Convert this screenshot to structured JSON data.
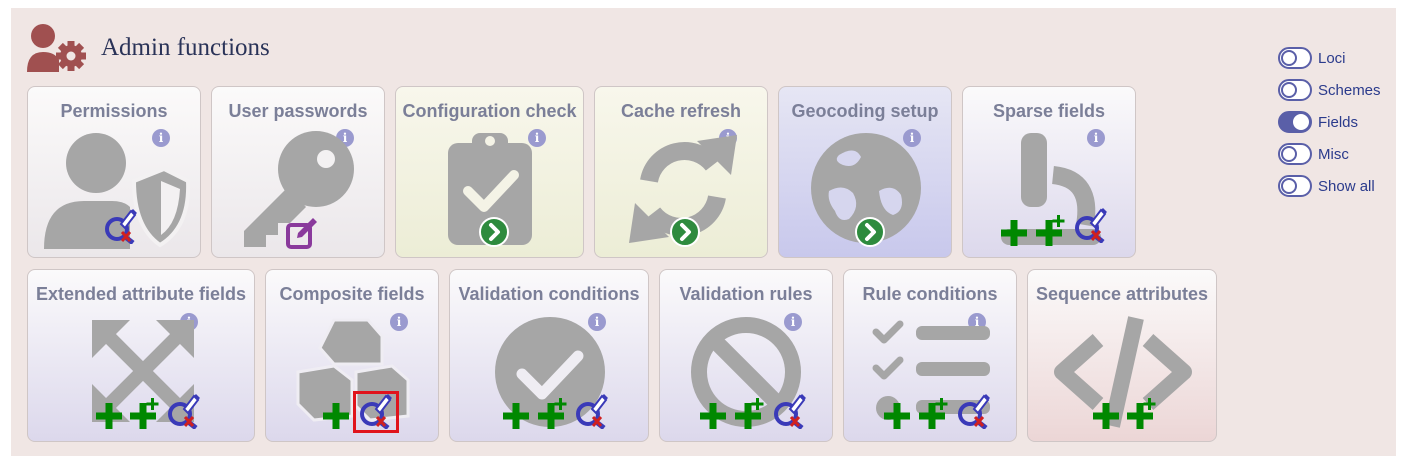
{
  "header": {
    "title": "Admin functions",
    "icon": "user-cog-icon"
  },
  "colors": {
    "icon_grey": "#a6a6a6",
    "header_icon": "#a05050",
    "plus_green": "#008800",
    "query_blue": "#3a3ab8",
    "toggle": "#5a5fa8",
    "highlight": "#e0141c"
  },
  "tiles_row1": [
    {
      "label": "Permissions",
      "icon": "user-shield-icon",
      "badges": [
        "query-icon"
      ]
    },
    {
      "label": "User passwords",
      "icon": "key-icon",
      "badges": [
        "edit-icon"
      ]
    },
    {
      "label": "Configuration check",
      "icon": "clipboard-check-icon",
      "badges": [
        "go-icon"
      ]
    },
    {
      "label": "Cache refresh",
      "icon": "refresh-icon",
      "badges": [
        "go-icon"
      ]
    },
    {
      "label": "Geocoding setup",
      "icon": "globe-icon",
      "badges": [
        "go-icon"
      ]
    },
    {
      "label": "Sparse fields",
      "icon": "microscope-icon",
      "badges": [
        "add-icon",
        "batch-add-icon",
        "query-icon"
      ]
    }
  ],
  "tiles_row2": [
    {
      "label": "Extended attribute fields",
      "icon": "expand-arrows-icon",
      "badges": [
        "add-icon",
        "batch-add-icon",
        "query-icon"
      ]
    },
    {
      "label": "Composite fields",
      "icon": "cubes-icon",
      "badges": [
        "add-icon",
        "query-icon"
      ]
    },
    {
      "label": "Validation conditions",
      "icon": "check-circle-icon",
      "badges": [
        "add-icon",
        "batch-add-icon",
        "query-icon"
      ]
    },
    {
      "label": "Validation rules",
      "icon": "ban-icon",
      "badges": [
        "add-icon",
        "batch-add-icon",
        "query-icon"
      ]
    },
    {
      "label": "Rule conditions",
      "icon": "tasks-icon",
      "badges": [
        "add-icon",
        "batch-add-icon",
        "query-icon"
      ]
    },
    {
      "label": "Sequence attributes",
      "icon": "code-icon",
      "badges": [
        "add-icon",
        "batch-add-icon"
      ]
    }
  ],
  "info_glyph": "i",
  "toggles": [
    {
      "label": "Loci",
      "on": false
    },
    {
      "label": "Schemes",
      "on": false
    },
    {
      "label": "Fields",
      "on": true
    },
    {
      "label": "Misc",
      "on": false
    },
    {
      "label": "Show all",
      "on": false
    }
  ]
}
